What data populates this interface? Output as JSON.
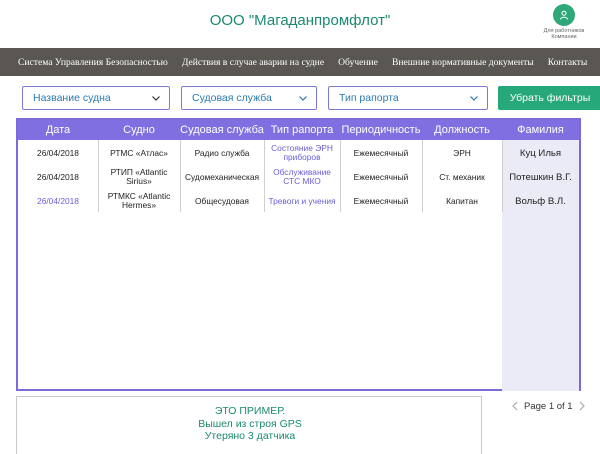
{
  "header": {
    "company": "ООО \"Магаданпромфлот\"",
    "user_label": "Для работников Компании"
  },
  "nav": {
    "items": [
      "Система Управления Безопасностью",
      "Действия в случае аварии на судне",
      "Обучение",
      "Внешние нормативные документы",
      "Контакты"
    ]
  },
  "filters": {
    "vessel": "Название судна",
    "service": "Судовая служба",
    "report_type": "Тип рапорта",
    "reset": "Убрать фильтры"
  },
  "table": {
    "columns": [
      "Дата",
      "Судно",
      "Судовая служба",
      "Тип рапорта",
      "Периодичность",
      "Должность",
      "Фамилия"
    ],
    "rows": [
      {
        "date": "26/04/2018",
        "vessel": "РТМС «Атлас»",
        "service": "Радио служба",
        "report_type": "Состояние ЭРН приборов",
        "periodicity": "Ежемесячный",
        "position": "ЭРН",
        "surname": "Куц Илья"
      },
      {
        "date": "26/04/2018",
        "vessel": "РТИП «Atlantic Sirius»",
        "service": "Судомеханическая",
        "report_type": "Обслуживание СТС МКО",
        "periodicity": "Ежемесячный",
        "position": "Ст. механик",
        "surname": "Потешкин В.Г."
      },
      {
        "date": "26/04/2018",
        "vessel": "РТМКС «Atlantic Hermes»",
        "service": "Общесудовая",
        "report_type": "Тревоги и учения",
        "periodicity": "Ежемесячный",
        "position": "Капитан",
        "surname": "Вольф В.Л."
      }
    ]
  },
  "note": {
    "line1": "ЭТО ПРИМЕР.",
    "line2": "Вышел из строя GPS",
    "line3": "Утеряно 3 датчика"
  },
  "pager": {
    "text": "Page 1 of 1"
  },
  "colors": {
    "accent": "#27a87a",
    "nav_bg": "#5a5753",
    "table_header": "#7f6fe0",
    "link": "#6a5fd6"
  }
}
